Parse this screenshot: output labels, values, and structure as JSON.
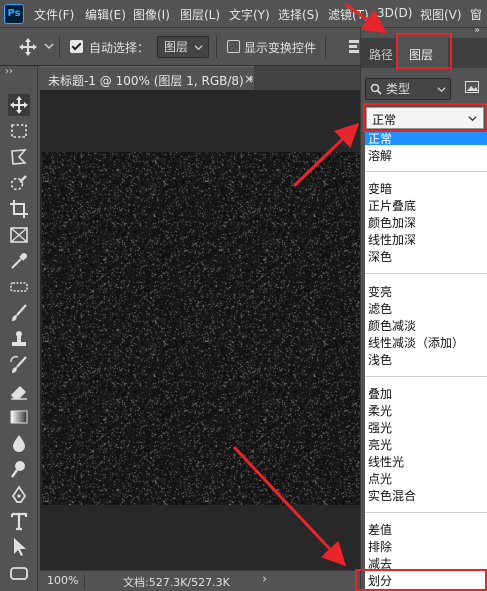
{
  "menubar": {
    "logo": "Ps",
    "items": [
      "文件(F)",
      "编辑(E)",
      "图像(I)",
      "图层(L)",
      "文字(Y)",
      "选择(S)",
      "滤镜(T)",
      "3D(D)",
      "视图(V)",
      "窗"
    ]
  },
  "options": {
    "auto_select_label": "自动选择：",
    "auto_select_target": "图层",
    "show_transform_label": "显示变换控件"
  },
  "document": {
    "tab_title": "未标题-1 @ 100% (图层 1, RGB/8) *",
    "close_glyph": "×"
  },
  "status": {
    "zoom": "100%",
    "doc_info": "文档:527.3K/527.3K",
    "arrow": "›"
  },
  "panel": {
    "expand_glyph": "»",
    "tabs": [
      "路径",
      "图层"
    ],
    "filter_kind": "类型",
    "blend_mode": "正常"
  },
  "blend_modes": {
    "groups": [
      [
        "正常",
        "溶解"
      ],
      [
        "变暗",
        "正片叠底",
        "颜色加深",
        "线性加深",
        "深色"
      ],
      [
        "变亮",
        "滤色",
        "颜色减淡",
        "线性减淡（添加）",
        "浅色"
      ],
      [
        "叠加",
        "柔光",
        "强光",
        "亮光",
        "线性光",
        "点光",
        "实色混合"
      ],
      [
        "差值",
        "排除",
        "减去",
        "划分"
      ]
    ],
    "highlighted": "正常"
  },
  "colors": {
    "ui_bg": "#535353",
    "canvas_bg": "#141414",
    "highlight": "#1e90ff",
    "annotation": "#e8252b"
  }
}
